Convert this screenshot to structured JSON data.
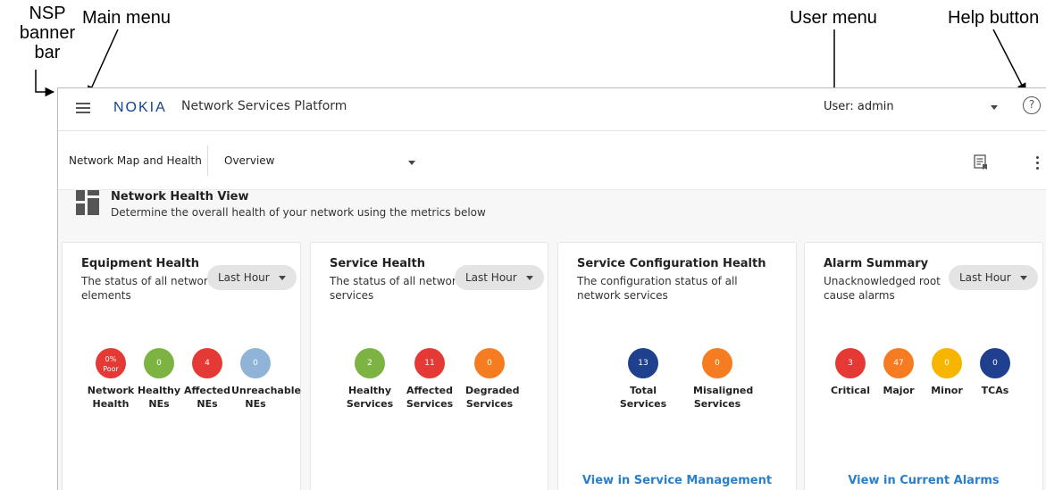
{
  "annotations": {
    "nsp_banner_bar": "NSP\nbanner\nbar",
    "main_menu": "Main menu",
    "user_menu": "User menu",
    "help_button": "Help button"
  },
  "banner": {
    "logo": "NOKIA",
    "app_title": "Network Services Platform",
    "user_label": "User: admin",
    "help_glyph": "?"
  },
  "subbar": {
    "crumb": "Network Map and Health",
    "view": "Overview"
  },
  "health_view": {
    "title": "Network Health View",
    "subtitle": "Determine the overall health of your network using the metrics below"
  },
  "cards": {
    "equipment": {
      "title": "Equipment Health",
      "desc": "The status of all network elements",
      "time_range": "Last Hour",
      "metrics": [
        {
          "value": "0%",
          "sub": "Poor",
          "label": "Network Health",
          "color": "#e53935"
        },
        {
          "value": "0",
          "label": "Healthy NEs",
          "color": "#7cb342"
        },
        {
          "value": "4",
          "label": "Affected NEs",
          "color": "#e53935"
        },
        {
          "value": "0",
          "label": "Unreachable NEs",
          "color": "#90b4d8"
        }
      ]
    },
    "service": {
      "title": "Service Health",
      "desc": "The status of all network services",
      "time_range": "Last Hour",
      "metrics": [
        {
          "value": "2",
          "label": "Healthy Services",
          "color": "#7cb342"
        },
        {
          "value": "11",
          "label": "Affected Services",
          "color": "#e53935"
        },
        {
          "value": "0",
          "label": "Degraded Services",
          "color": "#f57c20"
        }
      ]
    },
    "config": {
      "title": "Service Configuration Health",
      "desc": "The configuration status of all network services",
      "metrics": [
        {
          "value": "13",
          "label": "Total Services",
          "color": "#1f3f8f"
        },
        {
          "value": "0",
          "label": "Misaligned Services",
          "color": "#f57c20"
        }
      ],
      "link": "View in Service Management"
    },
    "alarms": {
      "title": "Alarm Summary",
      "desc": "Unacknowledged root cause alarms",
      "time_range": "Last Hour",
      "metrics": [
        {
          "value": "3",
          "label": "Critical",
          "color": "#e53935"
        },
        {
          "value": "47",
          "label": "Major",
          "color": "#f57c20"
        },
        {
          "value": "0",
          "label": "Minor",
          "color": "#f7b500"
        },
        {
          "value": "0",
          "label": "TCAs",
          "color": "#1f3f8f"
        }
      ],
      "link": "View in Current Alarms"
    }
  }
}
